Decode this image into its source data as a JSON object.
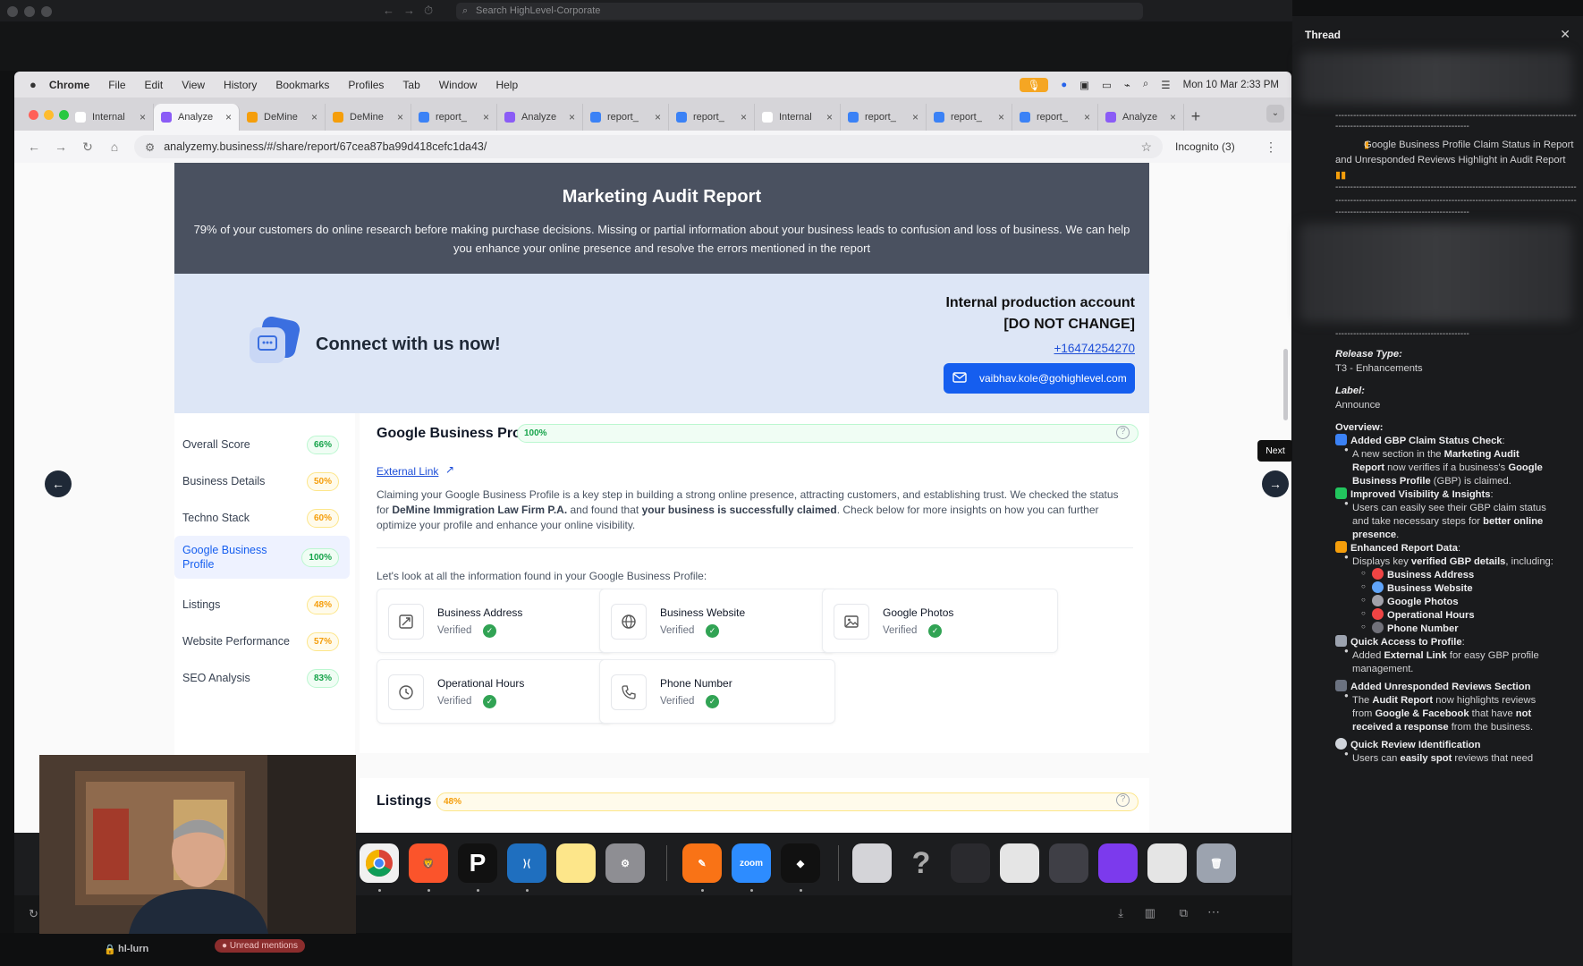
{
  "outer": {
    "search_placeholder": "Search HighLevel-Corporate"
  },
  "menubar": {
    "app": "Chrome",
    "items": [
      "File",
      "Edit",
      "View",
      "History",
      "Bookmarks",
      "Profiles",
      "Tab",
      "Window",
      "Help"
    ],
    "datetime": "Mon 10 Mar  2:33 PM"
  },
  "tabs": [
    {
      "label": "Internal",
      "fav": "#ffffff",
      "active": false
    },
    {
      "label": "Analyze",
      "fav": "#8b5cf6",
      "active": true
    },
    {
      "label": "DeMine",
      "fav": "#f59e0b",
      "active": false
    },
    {
      "label": "DeMine",
      "fav": "#f59e0b",
      "active": false
    },
    {
      "label": "report_",
      "fav": "#3b82f6",
      "active": false
    },
    {
      "label": "Analyze",
      "fav": "#8b5cf6",
      "active": false
    },
    {
      "label": "report_",
      "fav": "#3b82f6",
      "active": false
    },
    {
      "label": "report_",
      "fav": "#3b82f6",
      "active": false
    },
    {
      "label": "Internal",
      "fav": "#ffffff",
      "active": false
    },
    {
      "label": "report_",
      "fav": "#3b82f6",
      "active": false
    },
    {
      "label": "report_",
      "fav": "#3b82f6",
      "active": false
    },
    {
      "label": "report_",
      "fav": "#3b82f6",
      "active": false
    },
    {
      "label": "Analyze",
      "fav": "#8b5cf6",
      "active": false
    }
  ],
  "address": {
    "url": "analyzemy.business/#/share/report/67cea87ba99d418cefc1da43/",
    "incognito": "Incognito (3)"
  },
  "report": {
    "title": "Marketing Audit Report",
    "intro": "79% of your customers do online research before making purchase decisions. Missing or partial information about your business leads to confusion and loss of business. We can help you enhance your online presence and resolve the errors mentioned in the report",
    "connect_title": "Connect with us now!",
    "account_line1": "Internal production account",
    "account_line2": "[DO NOT CHANGE]",
    "phone": "+16474254270",
    "email": "vaibhav.kole@gohighlevel.com"
  },
  "sidebar": [
    {
      "label": "Overall Score",
      "score": "66%",
      "tone": "green"
    },
    {
      "label": "Business Details",
      "score": "50%",
      "tone": "orange"
    },
    {
      "label": "Techno Stack",
      "score": "60%",
      "tone": "orange"
    },
    {
      "label": "Google Business Profile",
      "score": "100%",
      "tone": "green",
      "active": true
    },
    {
      "label": "Listings",
      "score": "48%",
      "tone": "orange"
    },
    {
      "label": "Website Performance",
      "score": "57%",
      "tone": "orange"
    },
    {
      "label": "SEO Analysis",
      "score": "83%",
      "tone": "green"
    }
  ],
  "gbp": {
    "title": "Google Business Profile",
    "score": "100%",
    "external_link": "External Link",
    "desc_1": "Claiming your Google Business Profile is a key step in building a strong online presence, attracting customers, and establishing trust. We checked the status for ",
    "desc_business": "DeMine Immigration Law Firm P.A.",
    "desc_2": " and found that ",
    "desc_claimed": "your business is successfully claimed",
    "desc_3": ". Check below for more insights on how you can further optimize your profile and enhance your online visibility.",
    "look_text": "Let's look at all the information found in your Google Business Profile:",
    "cards": [
      {
        "title": "Business Address",
        "status": "Verified",
        "icon": "address-icon"
      },
      {
        "title": "Business Website",
        "status": "Verified",
        "icon": "globe-icon"
      },
      {
        "title": "Google Photos",
        "status": "Verified",
        "icon": "image-icon"
      },
      {
        "title": "Operational Hours",
        "status": "Verified",
        "icon": "clock-icon"
      },
      {
        "title": "Phone Number",
        "status": "Verified",
        "icon": "phone-icon"
      }
    ]
  },
  "listings": {
    "title": "Listings",
    "score": "48%"
  },
  "nav": {
    "next_tooltip": "Next"
  },
  "dock": {
    "zoom_label": "zoom"
  },
  "bottom": {
    "channel": "hl-lurn",
    "unread": "Unread mentions"
  },
  "thread": {
    "title": "Thread",
    "headline": "Google Business Profile Claim Status in Report and Unresponded Reviews Highlight in Audit Report",
    "release_type_label": "Release Type:",
    "release_type": "T3 - Enhancements",
    "label_label": "Label:",
    "label": "Announce",
    "overview_label": "Overview:",
    "s1_title": "Added GBP Claim Status Check",
    "s1_b1_a": "A new section in the ",
    "s1_b1_b": "Marketing Audit",
    "s1_b1_c": "Report",
    "s1_b1_d": " now verifies if a business's ",
    "s1_b1_e": "Google",
    "s1_b1_f": "Business Profile",
    "s1_b1_g": " (GBP) is claimed.",
    "s2_title": "Improved Visibility & Insights",
    "s2_b1_a": "Users can easily see their GBP claim status",
    "s2_b1_b": "and take necessary steps for ",
    "s2_b1_c": "better online",
    "s2_b1_d": "presence",
    "s3_title": "Enhanced Report Data",
    "s3_b1_a": "Displays key ",
    "s3_b1_b": "verified GBP details",
    "s3_b1_c": ", including:",
    "s3_sub": [
      "Business Address",
      "Business Website",
      "Google Photos",
      "Operational Hours",
      "Phone Number"
    ],
    "s4_title": "Quick Access to Profile",
    "s4_b1_a": "Added ",
    "s4_b1_b": "External Link",
    "s4_b1_c": " for easy GBP profile",
    "s4_b1_d": "management.",
    "s5_title": "Added Unresponded Reviews Section",
    "s5_b1_a": "The ",
    "s5_b1_b": "Audit Report",
    "s5_b1_c": " now highlights reviews",
    "s5_b1_d": "from ",
    "s5_b1_e": "Google & Facebook",
    "s5_b1_f": " that have ",
    "s5_b1_g": "not",
    "s5_b1_h": "received a response",
    "s5_b1_i": " from the business.",
    "s6_title": "Quick Review Identification",
    "s6_b1_a": "Users can ",
    "s6_b1_b": "easily spot",
    "s6_b1_c": " reviews that need"
  }
}
